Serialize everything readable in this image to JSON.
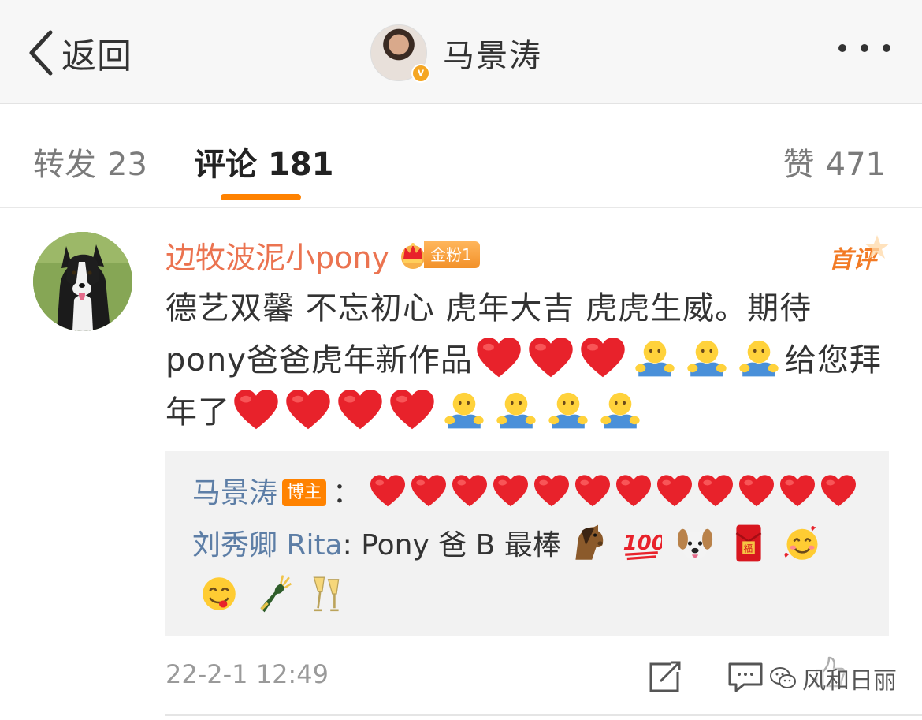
{
  "header": {
    "back_label": "返回",
    "profile_name": "马景涛"
  },
  "tabs": {
    "reposts": {
      "label": "转发",
      "count": "23"
    },
    "comments": {
      "label": "评论",
      "count": "181",
      "active": true
    },
    "likes": {
      "label": "赞",
      "count": "471"
    }
  },
  "comment": {
    "author": "边牧波泥小pony",
    "fan_badge": "金粉1",
    "first_comment_label": "首评",
    "text_1": "德艺双馨 不忘初心 虎年大吉 虎虎生威。期待pony爸爸虎年新作品",
    "text_2": "给您拜年了",
    "time": "22-2-1 12:49"
  },
  "replies": [
    {
      "name": "马景涛",
      "badge": "博主",
      "separator": "："
    },
    {
      "name": "刘秀卿 Rita",
      "separator": ": ",
      "text": "Pony 爸 B 最棒"
    }
  ],
  "watermark": "风和日丽",
  "colors": {
    "accent": "#ff8200",
    "author": "#eb7350",
    "reply_name": "#5d7ea6",
    "heart": "#e8222b"
  },
  "icons": {
    "heart": "red-heart-emoji",
    "hug": "hug-emoji",
    "horse": "horse-emoji",
    "hundred": "hundred-points-emoji",
    "dog": "dog-face-emoji",
    "red_envelope": "red-envelope-emoji",
    "hearts_face": "smiling-face-with-hearts-emoji",
    "yum": "yum-face-emoji",
    "champagne": "champagne-emoji",
    "clinking_glasses": "clinking-glasses-emoji"
  }
}
